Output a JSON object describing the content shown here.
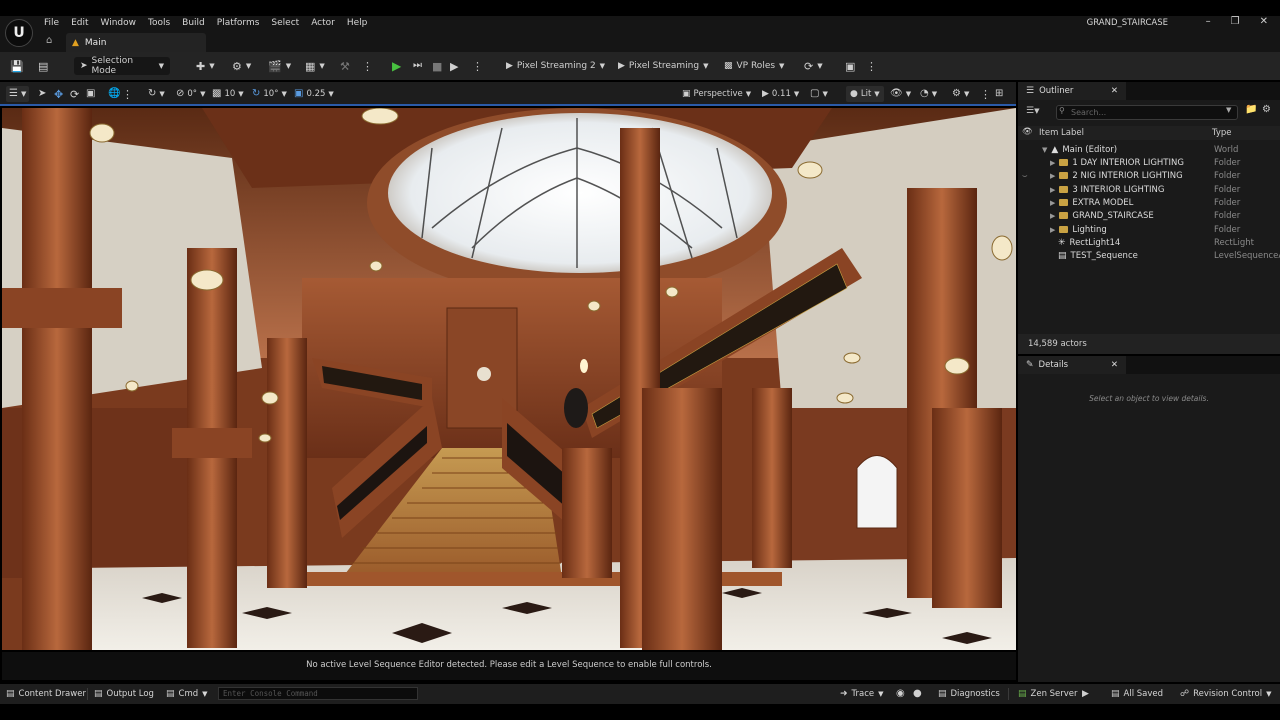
{
  "menu": [
    "File",
    "Edit",
    "Window",
    "Tools",
    "Build",
    "Platforms",
    "Select",
    "Actor",
    "Help"
  ],
  "project_name": "GRAND_STAIRCASE",
  "level_tab": "Main",
  "toolbar": {
    "mode": "Selection Mode",
    "pixel_streaming_2": "Pixel Streaming 2",
    "pixel_streaming": "Pixel Streaming",
    "vp_roles": "VP Roles"
  },
  "viewport_bar": {
    "translate_snap": "0°",
    "grid_snap": "10",
    "rotate_snap": "10°",
    "scale_snap": "0.25",
    "view_mode_perspective": "Perspective",
    "camera_speed": "0.11",
    "lit": "Lit"
  },
  "viewport_message": "No active Level Sequence Editor detected. Please edit a Level Sequence to enable full controls.",
  "outliner": {
    "title": "Outliner",
    "search_placeholder": "Search...",
    "col_label": "Item Label",
    "col_type": "Type",
    "items": [
      {
        "label": "Main (Editor)",
        "type": "World"
      },
      {
        "label": "1 DAY INTERIOR LIGHTING",
        "type": "Folder"
      },
      {
        "label": "2 NIG INTERIOR LIGHTING",
        "type": "Folder"
      },
      {
        "label": "3 INTERIOR LIGHTING",
        "type": "Folder"
      },
      {
        "label": "EXTRA MODEL",
        "type": "Folder"
      },
      {
        "label": "GRAND_STAIRCASE",
        "type": "Folder"
      },
      {
        "label": "Lighting",
        "type": "Folder"
      },
      {
        "label": "RectLight14",
        "type": "RectLight"
      },
      {
        "label": "TEST_Sequence",
        "type": "LevelSequenceA"
      }
    ],
    "actor_count": "14,589 actors"
  },
  "details": {
    "title": "Details",
    "empty": "Select an object to view details."
  },
  "statusbar": {
    "content_drawer": "Content Drawer",
    "output_log": "Output Log",
    "cmd": "Cmd",
    "console_placeholder": "Enter Console Command",
    "trace": "Trace",
    "diagnostics": "Diagnostics",
    "zen_server": "Zen Server",
    "all_saved": "All Saved",
    "revision_control": "Revision Control"
  },
  "colors": {
    "accent_blue": "#2b5aa8",
    "play_green": "#48c040",
    "folder_gold": "#c9a243",
    "panel_bg": "#1a1a1a"
  }
}
